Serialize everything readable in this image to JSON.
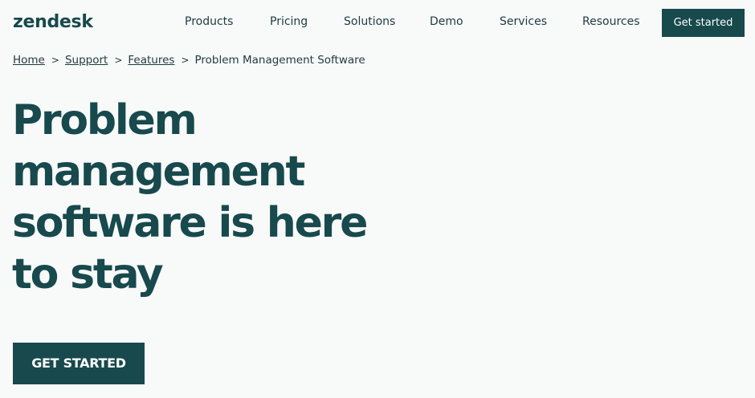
{
  "header": {
    "logo": "zendesk",
    "nav": [
      "Products",
      "Pricing",
      "Solutions",
      "Demo",
      "Services",
      "Resources"
    ],
    "cta_label": "Get started"
  },
  "breadcrumb": {
    "items": [
      "Home",
      "Support",
      "Features"
    ],
    "current": "Problem Management Software",
    "separator": ">"
  },
  "hero": {
    "title_lines": [
      "Problem",
      "management",
      "software is here",
      "to stay"
    ],
    "cta_label": "GET STARTED"
  },
  "colors": {
    "brand": "#17494d",
    "background": "#f8f9f9"
  }
}
